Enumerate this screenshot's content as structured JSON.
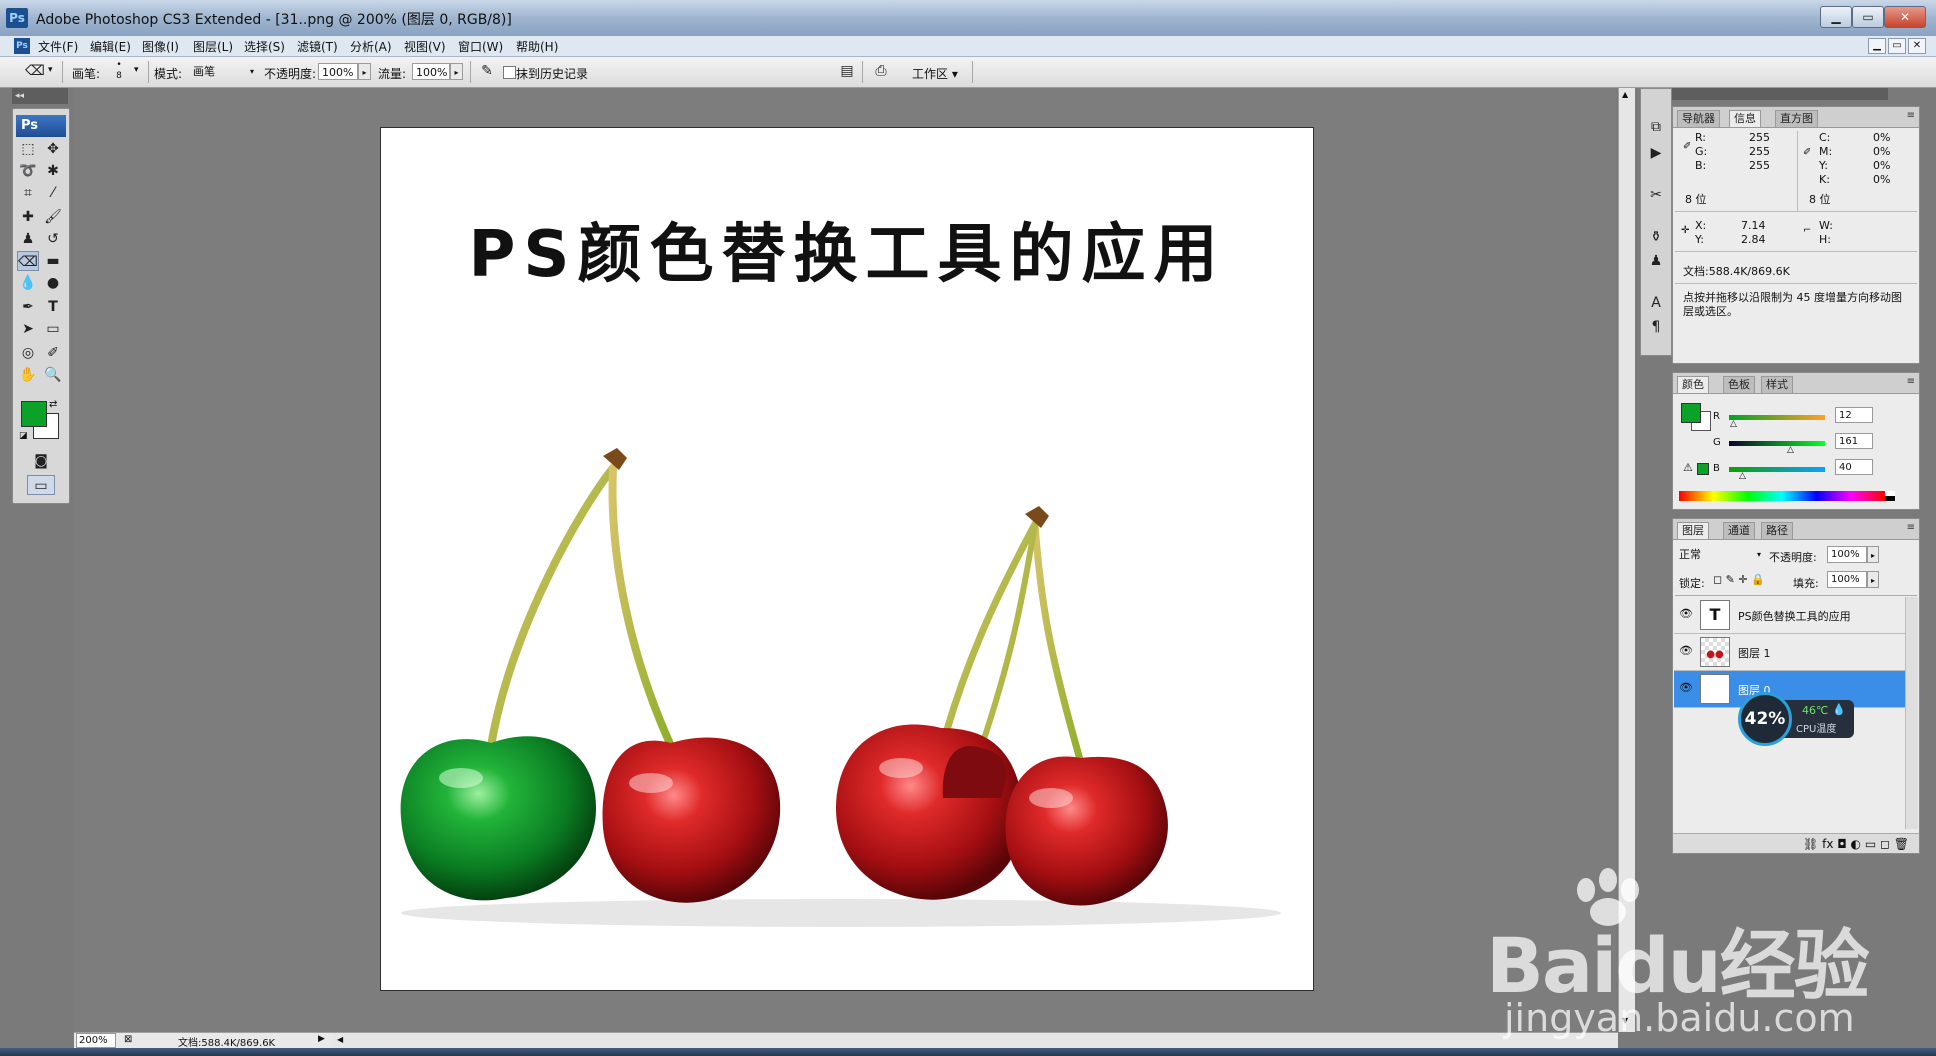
{
  "window": {
    "title": "Adobe Photoshop CS3 Extended - [31..png @ 200% (图层 0, RGB/8)]",
    "app_badge": "Ps",
    "min": "▁",
    "max": "▭",
    "close": "✕"
  },
  "menu": [
    "文件(F)",
    "编辑(E)",
    "图像(I)",
    "图层(L)",
    "选择(S)",
    "滤镜(T)",
    "分析(A)",
    "视图(V)",
    "窗口(W)",
    "帮助(H)"
  ],
  "options": {
    "brush_label": "画笔:",
    "brush_size": "8",
    "mode_label": "模式:",
    "mode_value": "画笔",
    "opacity_label": "不透明度:",
    "opacity_value": "100%",
    "flow_label": "流量:",
    "flow_value": "100%",
    "history_label": "抹到历史记录",
    "workspace_label": "工作区 ▾"
  },
  "toolbox": {
    "logo": "Ps"
  },
  "document": {
    "title_text": "PS颜色替换工具的应用",
    "zoom": "200%",
    "doc_size": "文档:588.4K/869.6K"
  },
  "info_panel": {
    "tabs": [
      "导航器",
      "信息",
      "直方图"
    ],
    "rgb": [
      {
        "k": "R:",
        "v": "255"
      },
      {
        "k": "G:",
        "v": "255"
      },
      {
        "k": "B:",
        "v": "255"
      }
    ],
    "cmyk": [
      {
        "k": "C:",
        "v": "0%"
      },
      {
        "k": "M:",
        "v": "0%"
      },
      {
        "k": "Y:",
        "v": "0%"
      },
      {
        "k": "K:",
        "v": "0%"
      }
    ],
    "bits_left": "8 位",
    "bits_right": "8 位",
    "x_label": "X:",
    "x_value": "7.14",
    "y_label": "Y:",
    "y_value": "2.84",
    "w_label": "W:",
    "h_label": "H:",
    "doc_size": "文档:588.4K/869.6K",
    "hint": "点按并拖移以沿限制为 45 度增量方向移动图层或选区。"
  },
  "color_panel": {
    "tabs": [
      "颜色",
      "色板",
      "样式"
    ],
    "r_label": "R",
    "r_value": "12",
    "g_label": "G",
    "g_value": "161",
    "b_label": "B",
    "b_value": "40",
    "fg_color": "#0ca128"
  },
  "layers_panel": {
    "tabs": [
      "图层",
      "通道",
      "路径"
    ],
    "blend_mode": "正常",
    "opacity_label": "不透明度:",
    "opacity_value": "100%",
    "lock_label": "锁定:",
    "fill_label": "填充:",
    "fill_value": "100%",
    "layers": [
      {
        "name": "PS颜色替换工具的应用",
        "thumb": "T"
      },
      {
        "name": "图层 1",
        "thumb": ""
      },
      {
        "name": "图层 0",
        "thumb": ""
      }
    ],
    "footer_icons": "⛓ fx ◘ ◐ ▭ ◻ 🗑"
  },
  "cpu_widget": {
    "percent": "42%",
    "temp": "46℃",
    "label": "CPU温度"
  },
  "watermark": {
    "brand": "Baidu经验",
    "url": "jingyan.baidu.com"
  }
}
